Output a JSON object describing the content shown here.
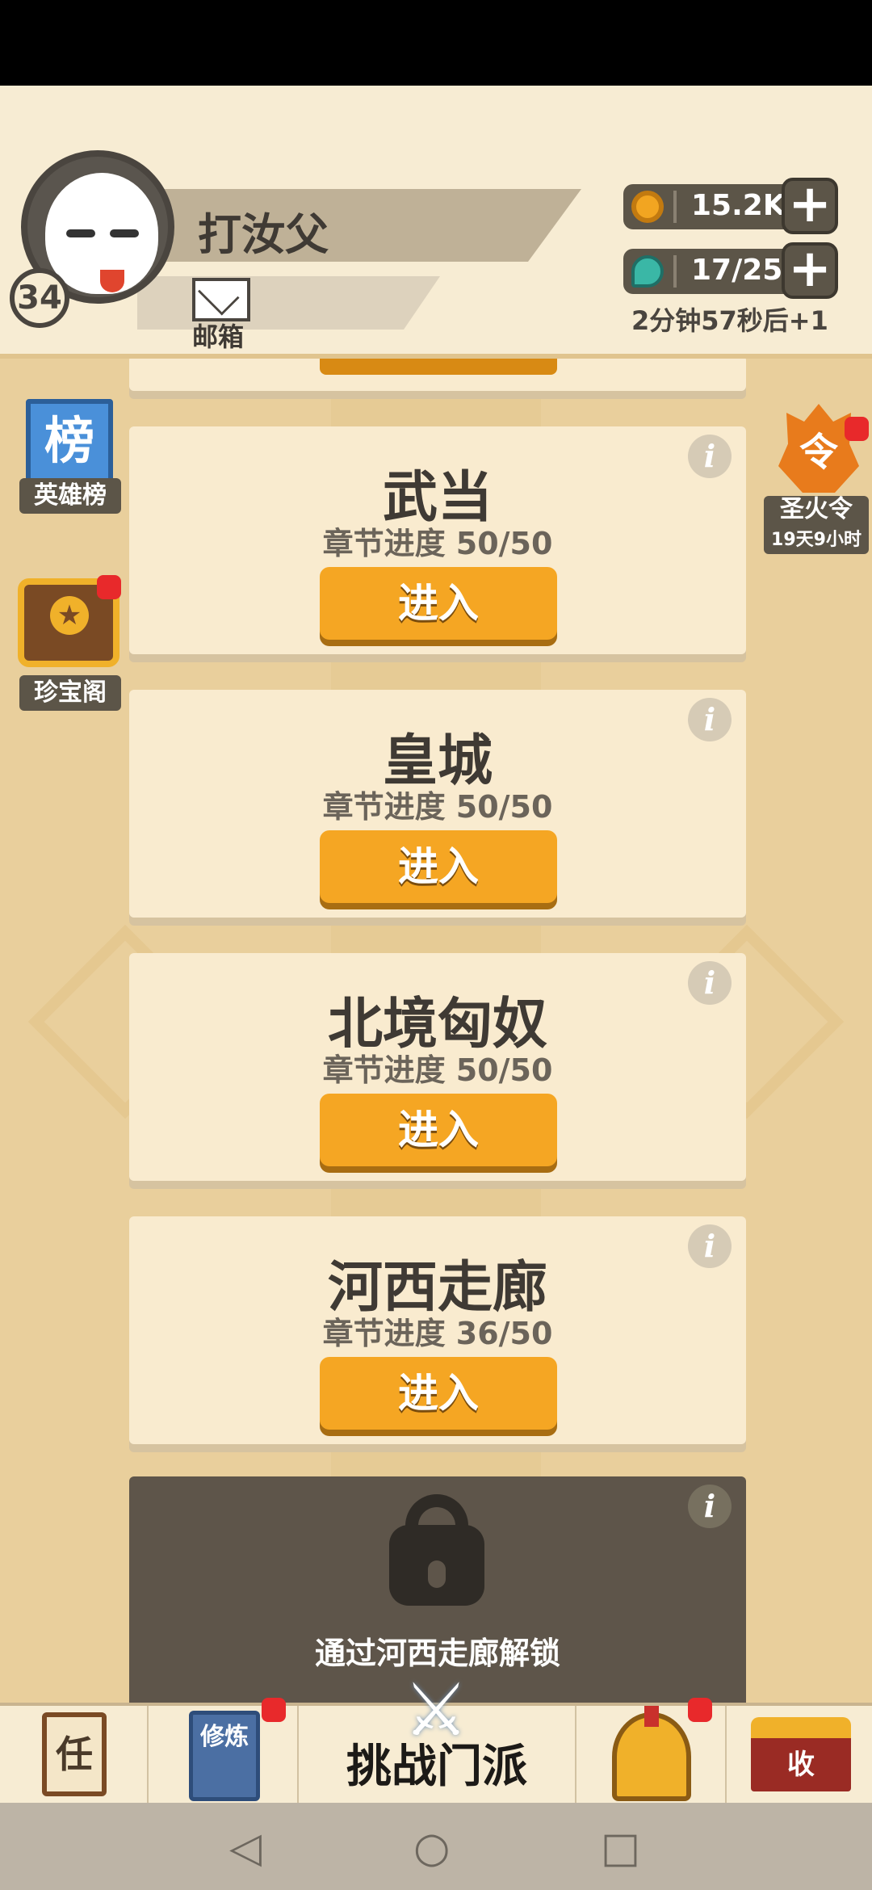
{
  "header": {
    "player_name": "打汝父",
    "level": "34",
    "mail_label": "邮箱",
    "coins": "15.2K",
    "energy": "17/25",
    "energy_timer": "2分钟57秒后+1",
    "plus_symbol": "+"
  },
  "side": {
    "rank_icon_text": "榜",
    "rank_label": "英雄榜",
    "chest_label": "珍宝阁",
    "fire_icon_text": "令",
    "fire_label": "圣火令",
    "fire_timer": "19天9小时"
  },
  "cards": [
    {
      "title": "武当",
      "progress": "章节进度 50/50",
      "button": "进入"
    },
    {
      "title": "皇城",
      "progress": "章节进度 50/50",
      "button": "进入"
    },
    {
      "title": "北境匈奴",
      "progress": "章节进度 50/50",
      "button": "进入"
    },
    {
      "title": "河西走廊",
      "progress": "章节进度 36/50",
      "button": "进入"
    }
  ],
  "info_symbol": "i",
  "locked": {
    "text": "通过河西走廊解锁"
  },
  "bottom_nav": {
    "task_icon_text": "任",
    "train_icon_text": "修炼",
    "challenge_label": "挑战门派",
    "shop_icon_text": "收"
  },
  "system_nav": {
    "back": "◁",
    "home": "○",
    "recent": "□"
  },
  "colors": {
    "accent": "#f5a623",
    "background": "#e9cf9c",
    "card": "#f9ebcf",
    "badge_red": "#e8292b"
  }
}
